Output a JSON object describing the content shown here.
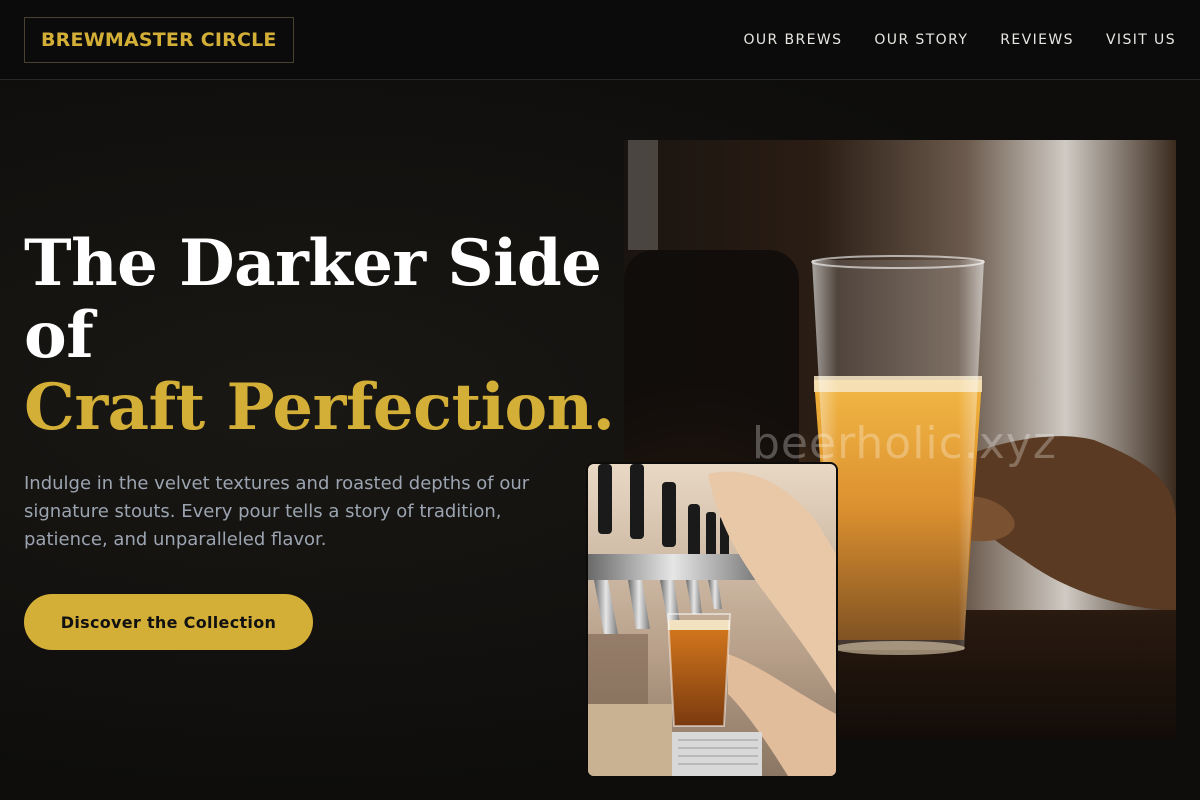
{
  "brand": {
    "name": "BREWMASTER CIRCLE",
    "accent_color": "#d4af37"
  },
  "nav": {
    "links": [
      "OUR BREWS",
      "OUR STORY",
      "REVIEWS",
      "VISIT US"
    ]
  },
  "hero": {
    "title_line1": "The Darker Side",
    "title_line2": "of",
    "title_accent": "Craft Perfection.",
    "description": "Indulge in the velvet textures and roasted depths of our signature stouts. Every pour tells a story of tradition, patience, and unparalleled flavor.",
    "cta_label": "Discover the Collection"
  },
  "images": {
    "main_photo": "beer-glass-photo",
    "small_photo": "tap-pouring-photo",
    "watermark": "beerholic.xyz"
  }
}
